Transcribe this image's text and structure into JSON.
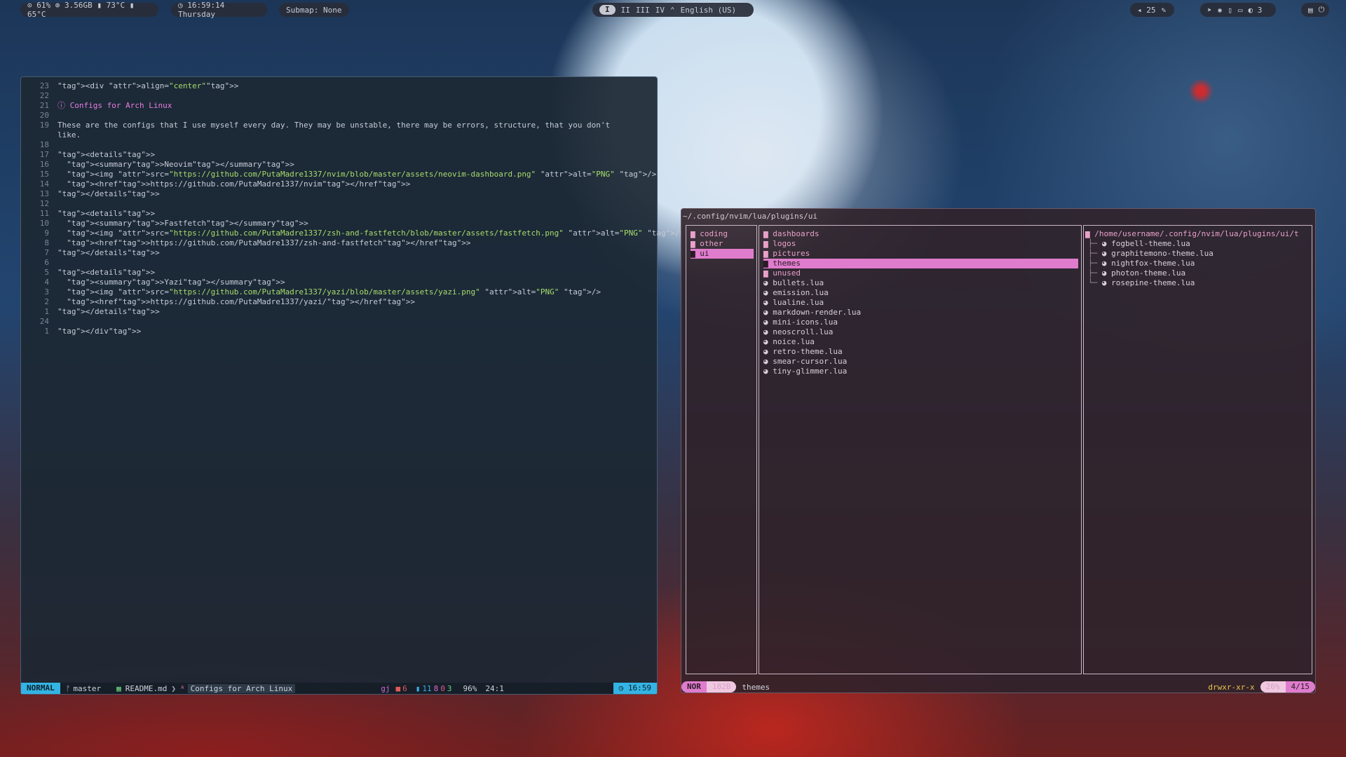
{
  "topbar": {
    "sysinfo": "⊙ 61%  ⊚ 3.56GB  ▮ 73°C  ▮ 65°C",
    "clock": "◷ 16:59:14 Thursday",
    "submap": "Submap: None",
    "workspaces": [
      "I",
      "II",
      "III",
      "IV"
    ],
    "layout": "English (US)",
    "volume": "◂ 25",
    "notifications": "◐ 3"
  },
  "nvim": {
    "lines": [
      {
        "n": "23",
        "t": "<div align=\"center\">"
      },
      {
        "n": "22",
        "t": ""
      },
      {
        "n": "21",
        "t": "ⓘ Configs for Arch Linux"
      },
      {
        "n": "20",
        "t": ""
      },
      {
        "n": "19",
        "t": "These are the configs that I use myself every day. They may be unstable, there may be errors, structure, that you don't"
      },
      {
        "n": "",
        "t": "like."
      },
      {
        "n": "18",
        "t": ""
      },
      {
        "n": "17",
        "t": "<details>"
      },
      {
        "n": "16",
        "t": "  <summary>Neovim</summary>"
      },
      {
        "n": "15",
        "t": "  <img src=\"https://github.com/PutaMadre1337/nvim/blob/master/assets/neovim-dashboard.png\" alt=\"PNG\" />"
      },
      {
        "n": "14",
        "t": "  <href>https://github.com/PutaMadre1337/nvim</href>"
      },
      {
        "n": "13",
        "t": "</details>"
      },
      {
        "n": "12",
        "t": ""
      },
      {
        "n": "11",
        "t": "<details>"
      },
      {
        "n": "10",
        "t": "  <summary>Fastfetch</summary>"
      },
      {
        "n": "9",
        "t": "  <img src=\"https://github.com/PutaMadre1337/zsh-and-fastfetch/blob/master/assets/fastfetch.png\" alt=\"PNG\" />"
      },
      {
        "n": "8",
        "t": "  <href>https://github.com/PutaMadre1337/zsh-and-fastfetch</href>"
      },
      {
        "n": "7",
        "t": "</details>"
      },
      {
        "n": "6",
        "t": ""
      },
      {
        "n": "5",
        "t": "<details>"
      },
      {
        "n": "4",
        "t": "  <summary>Yazi</summary>"
      },
      {
        "n": "3",
        "t": "  <img src=\"https://github.com/PutaMadre1337/yazi/blob/master/assets/yazi.png\" alt=\"PNG\" />"
      },
      {
        "n": "2",
        "t": "  <href>https://github.com/PutaMadre1337/yazi/</href>"
      },
      {
        "n": "1",
        "t": "</details>"
      },
      {
        "n": "24",
        "t": ""
      },
      {
        "n": "1",
        "t": "</div>"
      }
    ],
    "status": {
      "mode": "NORMAL",
      "branch": "master",
      "file": "README.md",
      "symbol": "Configs for Arch Linux",
      "keys": "gj",
      "errors": "6",
      "diag1": "11",
      "diag2": "8",
      "diag3": "0",
      "diag4": "3",
      "percent": "96%",
      "position": "24:1",
      "time": "16:59"
    }
  },
  "yazi": {
    "path": "~/.config/nvim/lua/plugins/ui",
    "parent": [
      "coding",
      "other",
      "ui"
    ],
    "current_dirs": [
      "dashboards",
      "logos",
      "pictures",
      "themes",
      "unused"
    ],
    "current_files": [
      "bullets.lua",
      "emission.lua",
      "lualine.lua",
      "markdown-render.lua",
      "mini-icons.lua",
      "neoscroll.lua",
      "noice.lua",
      "retro-theme.lua",
      "smear-cursor.lua",
      "tiny-glimmer.lua"
    ],
    "preview_header": "/home/username/.config/nvim/lua/plugins/ui/t",
    "preview": [
      "fogbell-theme.lua",
      "graphitemono-theme.lua",
      "nightfox-theme.lua",
      "photon-theme.lua",
      "rosepine-theme.lua"
    ],
    "status": {
      "mode": "NOR",
      "size": "182B",
      "name": "themes",
      "perms": "drwxr-xr-x",
      "percent": "26%",
      "pos": "4/15"
    }
  }
}
